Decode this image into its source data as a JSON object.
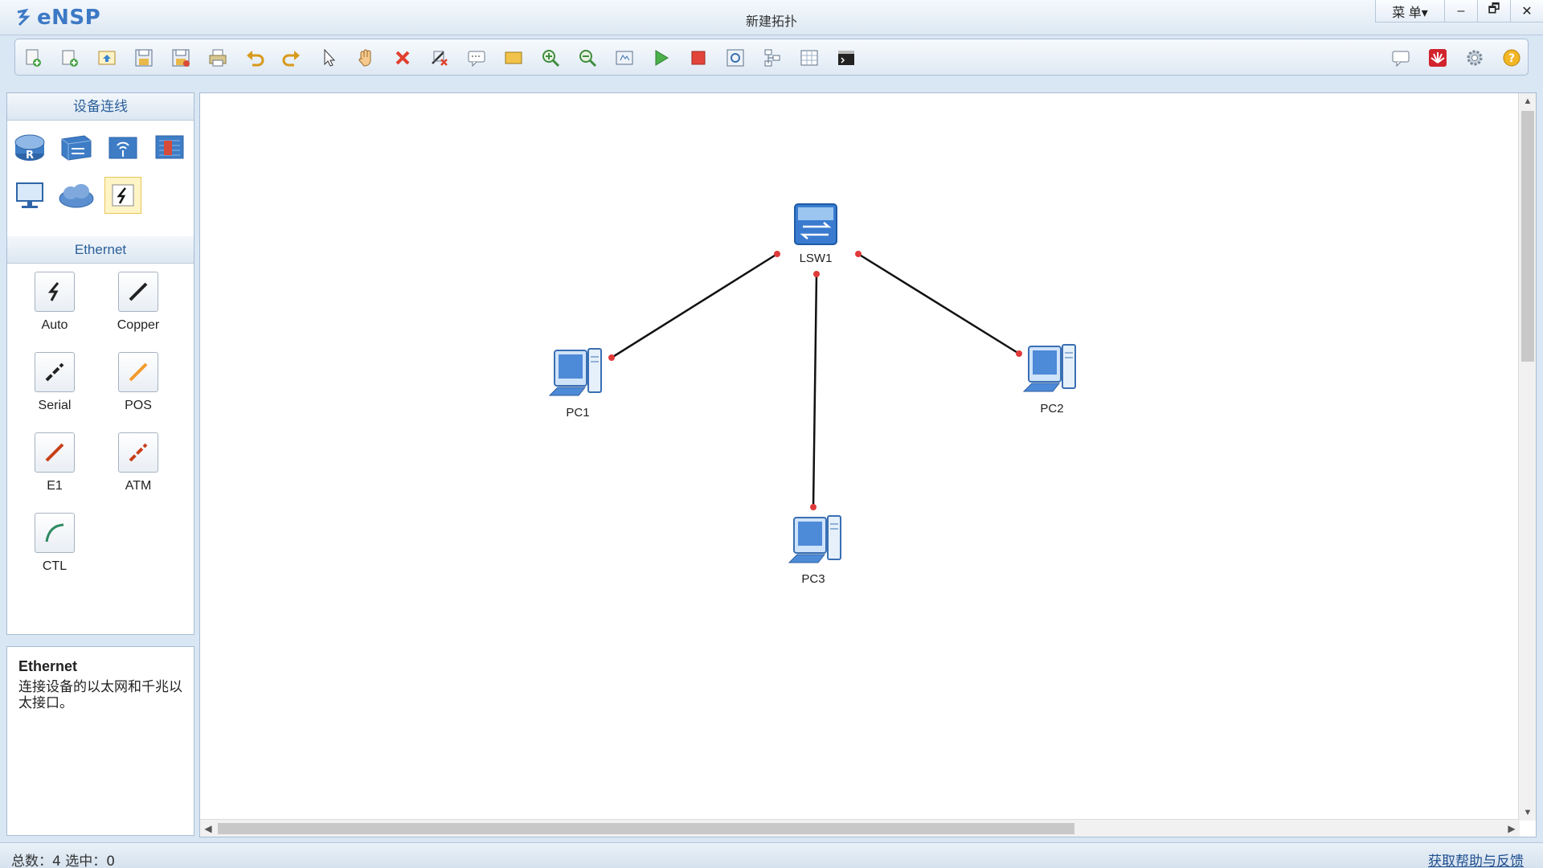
{
  "app": {
    "logo_text": "eNSP",
    "window_title": "新建拓扑"
  },
  "window_controls": {
    "menu": "菜 单▾",
    "minimize": "–",
    "restore": "🗗",
    "close": "✕"
  },
  "toolbar": {
    "left_icons": [
      "new-topology-icon",
      "new-example-icon",
      "open-icon",
      "save-icon",
      "save-as-icon",
      "print-icon",
      "undo-icon",
      "redo-icon",
      "select-pointer-icon",
      "pan-hand-icon",
      "delete-icon",
      "delete-links-icon",
      "text-note-icon",
      "rectangle-icon",
      "zoom-in-icon",
      "zoom-out-icon",
      "fit-view-icon",
      "start-device-icon",
      "stop-device-icon",
      "capture-icon",
      "topology-icon",
      "grid-icon",
      "cli-icon"
    ],
    "right_icons": [
      "chat-icon",
      "huawei-icon",
      "settings-icon",
      "help-icon"
    ]
  },
  "device_panel": {
    "title": "设备连线",
    "categories": [
      "router-icon",
      "switch-icon",
      "wireless-icon",
      "firewall-icon",
      "pc-terminal-icon",
      "cloud-icon",
      "connection-icon"
    ],
    "selected_category": "connection-icon",
    "section_title": "Ethernet",
    "cables": [
      {
        "label": "Auto",
        "color": "#222222"
      },
      {
        "label": "Copper",
        "color": "#222222"
      },
      {
        "label": "Serial",
        "color": "#222222"
      },
      {
        "label": "POS",
        "color": "#f39a2c"
      },
      {
        "label": "E1",
        "color": "#c8401a"
      },
      {
        "label": "ATM",
        "color": "#c8401a"
      },
      {
        "label": "CTL",
        "color": "#2f8a62"
      }
    ]
  },
  "description": {
    "title": "Ethernet",
    "text": "连接设备的以太网和千兆以太接口。"
  },
  "topology": {
    "nodes": [
      {
        "id": "LSW1",
        "label": "LSW1",
        "type": "switch"
      },
      {
        "id": "PC1",
        "label": "PC1",
        "type": "pc"
      },
      {
        "id": "PC2",
        "label": "PC2",
        "type": "pc"
      },
      {
        "id": "PC3",
        "label": "PC3",
        "type": "pc"
      }
    ],
    "links": [
      {
        "from": "LSW1",
        "to": "PC1"
      },
      {
        "from": "LSW1",
        "to": "PC2"
      },
      {
        "from": "LSW1",
        "to": "PC3"
      }
    ],
    "link_color": "#111111",
    "port_dot_color": "#e03a3a"
  },
  "statusbar": {
    "text": "总数：4  选中：0",
    "help_link": "获取帮助与反馈"
  }
}
